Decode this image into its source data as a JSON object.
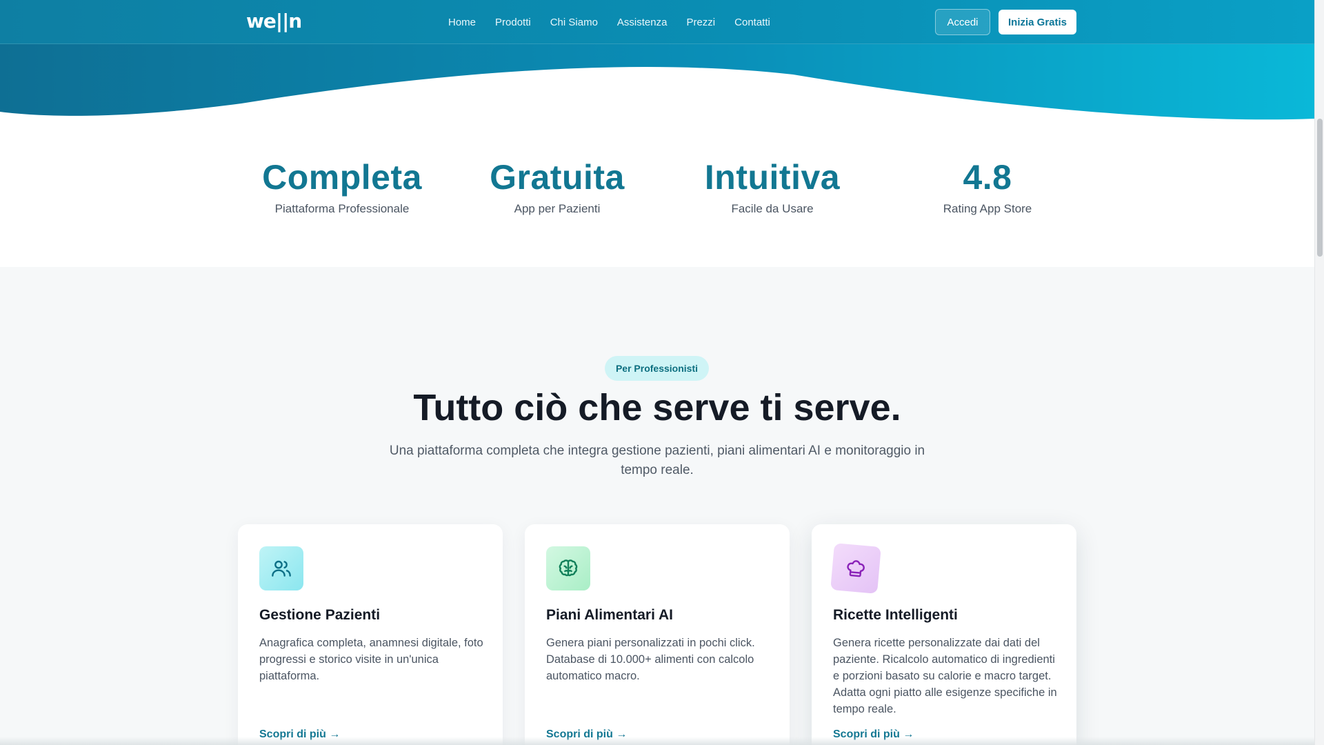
{
  "navbar": {
    "logo": "we||n",
    "links": [
      "Home",
      "Prodotti",
      "Chi Siamo",
      "Assistenza",
      "Prezzi",
      "Contatti"
    ],
    "login_label": "Accedi",
    "cta_label": "Inizia Gratis"
  },
  "stats": [
    {
      "value": "Completa",
      "label": "Piattaforma Professionale"
    },
    {
      "value": "Gratuita",
      "label": "App per Pazienti"
    },
    {
      "value": "Intuitiva",
      "label": "Facile da Usare"
    },
    {
      "value": "4.8",
      "label": "Rating App Store"
    }
  ],
  "features": {
    "badge": "Per Professionisti",
    "title": "Tutto ciò che serve ti serve.",
    "subtitle": "Una piattaforma completa che integra gestione pazienti, piani alimentari AI e monitoraggio in tempo reale.",
    "cards": [
      {
        "icon": "users-icon",
        "title": "Gestione Pazienti",
        "description": "Anagrafica completa, anamnesi digitale, foto progressi e storico visite in un'unica piattaforma.",
        "link": "Scopri di più →"
      },
      {
        "icon": "brain-icon",
        "title": "Piani Alimentari AI",
        "description": "Genera piani personalizzati in pochi click. Database di 10.000+ alimenti con calcolo automatico macro.",
        "link": "Scopri di più →"
      },
      {
        "icon": "chef-hat-icon",
        "title": "Ricette Intelligenti",
        "description": "Genera ricette personalizzate dai dati del paziente. Ricalcolo automatico di ingredienti e porzioni basato su calorie e macro target. Adatta ogni piatto alle esigenze specifiche in tempo reale.",
        "link": "Scopri di più →"
      }
    ]
  },
  "colors": {
    "brand": "#127792",
    "nav_gradient_start": "#0e7fa3",
    "nav_gradient_end": "#0aa0c6",
    "badge_bg": "#cff4f6"
  }
}
